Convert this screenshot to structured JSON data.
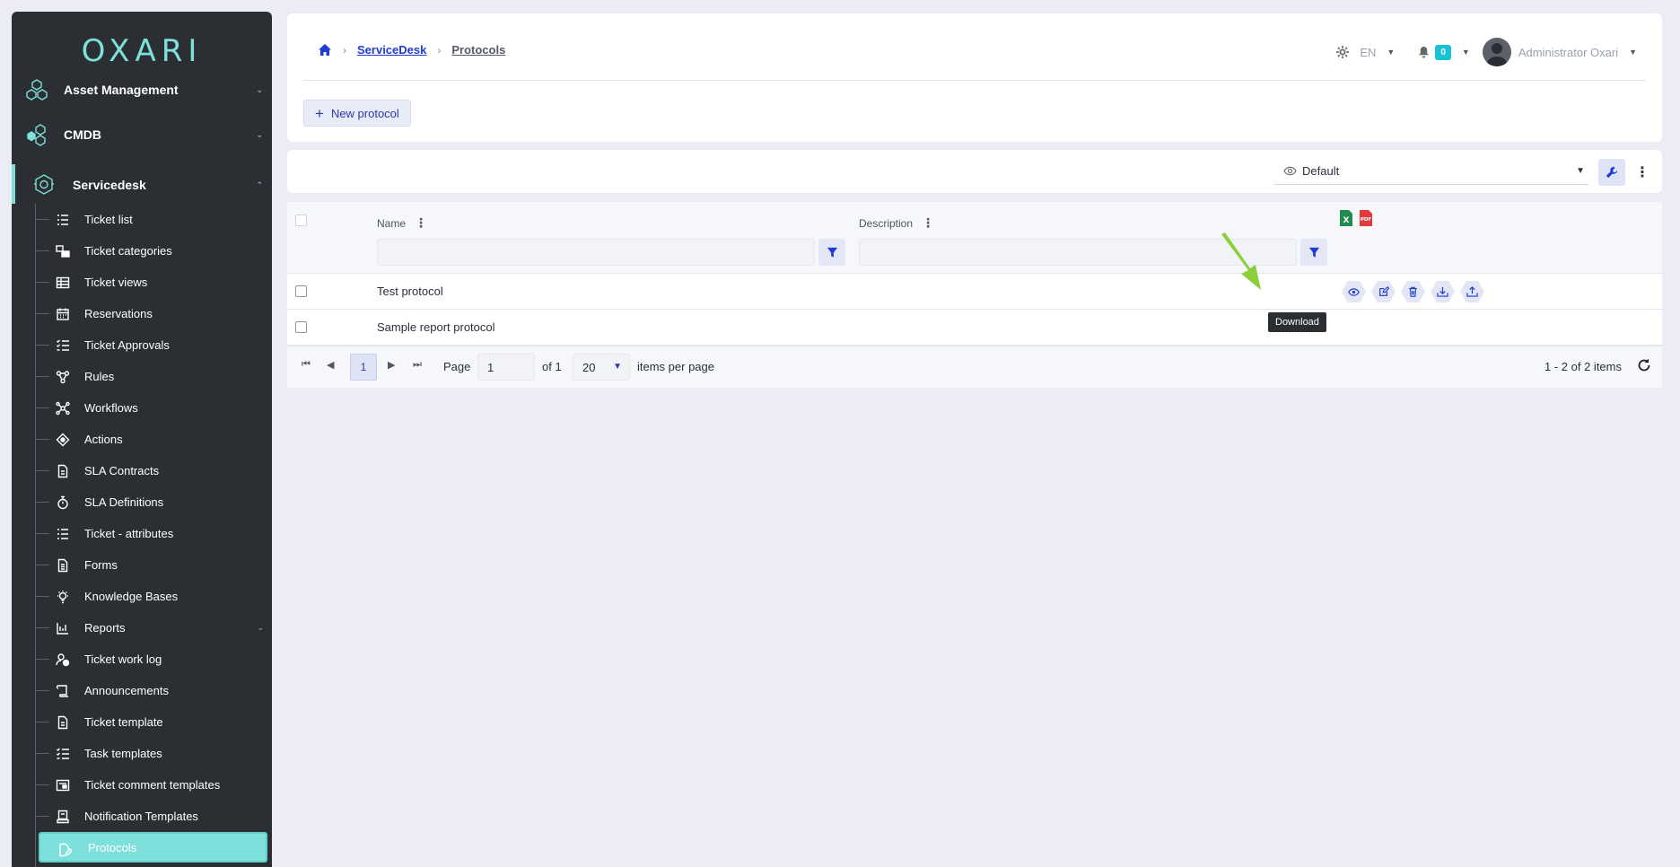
{
  "app": {
    "logo_text": "OXARI"
  },
  "sidebar": {
    "top_items": [
      {
        "label": "Asset Management",
        "icon": "hexagon-network-icon"
      },
      {
        "label": "CMDB",
        "icon": "hexagon-cluster-icon"
      },
      {
        "label": "Servicedesk",
        "icon": "headset-icon"
      }
    ],
    "sub_items": [
      {
        "label": "Ticket list",
        "icon": "list-icon"
      },
      {
        "label": "Ticket categories",
        "icon": "categories-icon"
      },
      {
        "label": "Ticket views",
        "icon": "table-icon"
      },
      {
        "label": "Reservations",
        "icon": "calendar-icon"
      },
      {
        "label": "Ticket Approvals",
        "icon": "checklist-icon"
      },
      {
        "label": "Rules",
        "icon": "rules-icon"
      },
      {
        "label": "Workflows",
        "icon": "workflow-icon"
      },
      {
        "label": "Actions",
        "icon": "actions-icon"
      },
      {
        "label": "SLA Contracts",
        "icon": "document-icon"
      },
      {
        "label": "SLA Definitions",
        "icon": "stopwatch-icon"
      },
      {
        "label": "Ticket - attributes",
        "icon": "list-icon"
      },
      {
        "label": "Forms",
        "icon": "form-icon"
      },
      {
        "label": "Knowledge Bases",
        "icon": "lightbulb-icon"
      },
      {
        "label": "Reports",
        "icon": "chart-icon"
      },
      {
        "label": "Ticket work log",
        "icon": "user-clock-icon"
      },
      {
        "label": "Announcements",
        "icon": "scroll-icon"
      },
      {
        "label": "Ticket template",
        "icon": "document-icon"
      },
      {
        "label": "Task templates",
        "icon": "checklist-icon"
      },
      {
        "label": "Ticket comment templates",
        "icon": "comment-template-icon"
      },
      {
        "label": "Notification Templates",
        "icon": "notification-template-icon"
      },
      {
        "label": "Protocols",
        "icon": "protocol-icon"
      }
    ]
  },
  "header": {
    "breadcrumb": {
      "home_icon": "home-icon",
      "servicedesk": "ServiceDesk",
      "current": "Protocols"
    },
    "language": "EN",
    "notifications_count": "0",
    "user_name": "Administrator Oxari",
    "new_button": "New protocol"
  },
  "toolbar": {
    "view_name": "Default"
  },
  "grid": {
    "columns": {
      "name": "Name",
      "description": "Description"
    },
    "rows": [
      {
        "name": "Test protocol"
      },
      {
        "name": "Sample report protocol"
      }
    ],
    "tooltip": "Download",
    "pager": {
      "current_page": "1",
      "page_label": "Page",
      "page_input": "1",
      "of_label": "of 1",
      "page_size": "20",
      "per_page_label": "items per page",
      "count_label": "1 - 2 of 2 items"
    }
  },
  "colors": {
    "accent": "#7de0da",
    "sidebar_bg": "#2b2e33",
    "primary": "#1f3bd6",
    "arrow": "#8bd03a"
  }
}
